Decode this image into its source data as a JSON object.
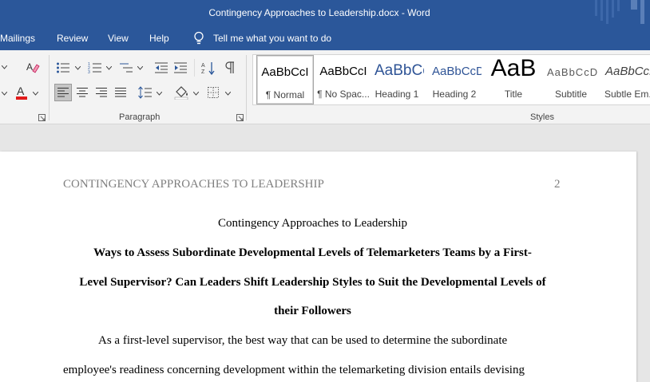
{
  "window": {
    "title": "Contingency Approaches to Leadership.docx  -  Word"
  },
  "menu": {
    "items": [
      "Mailings",
      "Review",
      "View",
      "Help"
    ],
    "tell_me": "Tell me what you want to do"
  },
  "ribbon": {
    "paragraph_group_label": "Paragraph",
    "styles_group_label": "Styles",
    "styles": [
      {
        "preview": "AaBbCcI",
        "name": "¶ Normal"
      },
      {
        "preview": "AaBbCcI",
        "name": "¶ No Spac..."
      },
      {
        "preview": "AaBbCc",
        "name": "Heading 1"
      },
      {
        "preview": "AaBbCcD",
        "name": "Heading 2"
      },
      {
        "preview": "AaB",
        "name": "Title"
      },
      {
        "preview": "AaBbCcD",
        "name": "Subtitle"
      },
      {
        "preview": "AaBbCcL",
        "name": "Subtle Em..."
      }
    ],
    "colors": {
      "word_blue": "#2b579a",
      "font_color_red": "#e21b1b",
      "heading_blue": "#2f5496"
    }
  },
  "document": {
    "running_head": "CONTINGENCY APPROACHES TO LEADERSHIP",
    "page_number": "2",
    "title": "Contingency Approaches to Leadership",
    "heading_lines": [
      "Ways to Assess Subordinate Developmental Levels of Telemarketers Teams by a First-",
      "Level Supervisor? Can Leaders Shift Leadership Styles to Suit the Developmental Levels of",
      "their Followers"
    ],
    "body_lines": [
      "As a first-level supervisor, the best way that can be used to determine the subordinate",
      "employee's readiness concerning development within the telemarketing division entails devising"
    ]
  }
}
